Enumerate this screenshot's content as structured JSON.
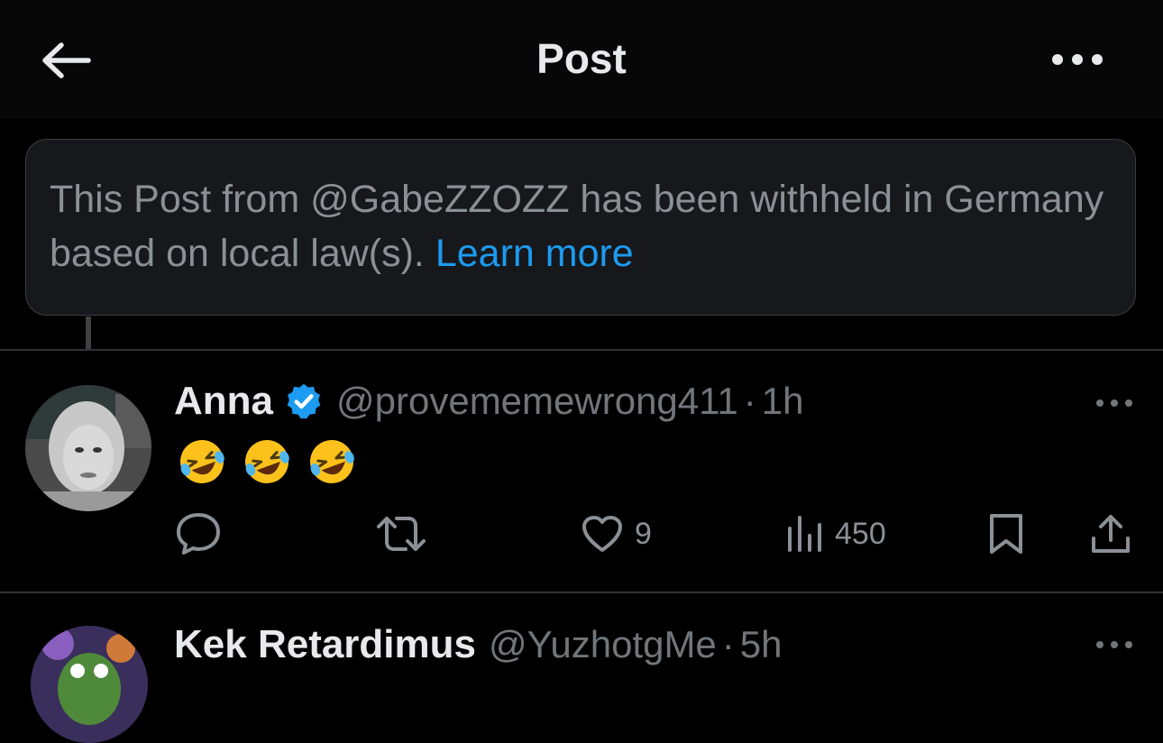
{
  "header": {
    "title": "Post",
    "back_icon": "arrow-left-icon",
    "more_icon": "more-horizontal-icon"
  },
  "notice": {
    "text": "This Post from @GabeZZOZZ has been withheld in Germany based on local law(s).",
    "link_label": "Learn more",
    "link_color": "#1d9bf0"
  },
  "posts": [
    {
      "display_name": "Anna",
      "verified": true,
      "handle": "@provememewrong411",
      "separator": "·",
      "time": "1h",
      "emojis": [
        "🤣",
        "🤣",
        "🤣"
      ],
      "actions": {
        "reply_icon": "reply-bubble-icon",
        "repost_icon": "repost-icon",
        "like_icon": "heart-icon",
        "like_count": "9",
        "views_icon": "views-bar-chart-icon",
        "view_count": "450",
        "bookmark_icon": "bookmark-icon",
        "share_icon": "share-upload-icon"
      }
    },
    {
      "display_name": "Kek Retardimus",
      "handle": "@YuzhotgMe",
      "separator": "·",
      "time": "5h"
    }
  ],
  "colors": {
    "background": "#000000",
    "header": "#070707",
    "notice_bg": "#17181b",
    "text_primary": "#e7e9ea",
    "text_secondary": "#71767b",
    "verified_badge": "#1d9bf0"
  }
}
